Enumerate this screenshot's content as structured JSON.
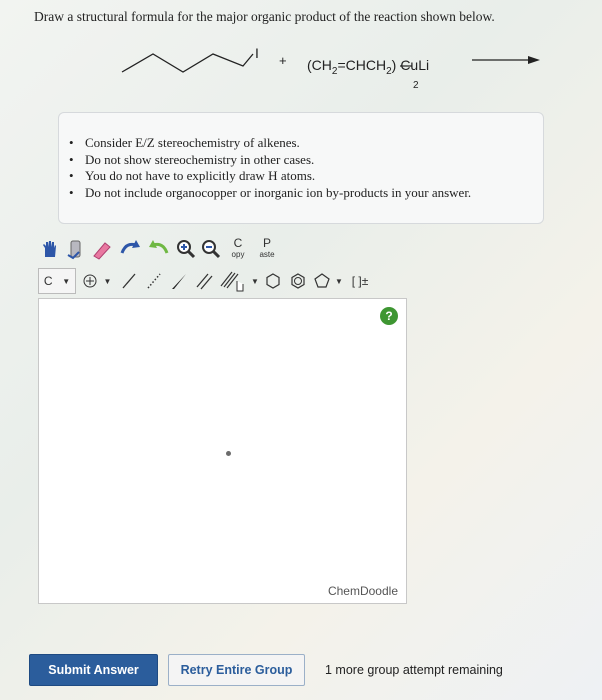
{
  "question": "Draw a structural formula for the major organic product of the reaction shown below.",
  "reaction": {
    "reagent1_label": "I",
    "plus": "+",
    "reagent2_main": "(CH",
    "reagent2_sub1": "2",
    "reagent2_mid": "=CHCH",
    "reagent2_sub2": "2",
    "reagent2_close": ")",
    "reagent2_end": "CuLi",
    "reagent2_count": "2"
  },
  "instructions": [
    "Consider E/Z stereochemistry of alkenes.",
    "Do not show stereochemistry in other cases.",
    "You do not have to explicitly draw H atoms.",
    "Do not include organocopper or inorganic ion by-products in your answer."
  ],
  "toolbar": {
    "copy_top": "C",
    "copy_bottom": "opy",
    "paste_top": "P",
    "paste_bottom": "aste",
    "atom_label": "C",
    "bracket_label": "[ ]±"
  },
  "canvas": {
    "help_label": "?",
    "brand": "ChemDoodle"
  },
  "buttons": {
    "submit": "Submit Answer",
    "retry": "Retry Entire Group"
  },
  "remaining": "1 more group attempt remaining"
}
